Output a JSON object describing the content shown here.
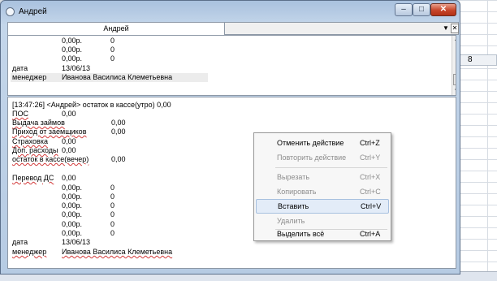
{
  "window": {
    "title": "Андрей"
  },
  "tabs": [
    {
      "label": "Андрей"
    }
  ],
  "background": {
    "column_label": "8"
  },
  "top_pane": {
    "rows": [
      {
        "c2": "0,00р.",
        "c3": "0"
      },
      {
        "c2": "0,00р.",
        "c3": "0"
      },
      {
        "c2": "0,00р.",
        "c3": "0"
      }
    ],
    "date_label": "дата",
    "date_value": "13/06/13",
    "manager_label": "менеджер",
    "manager_value": "Иванова Василиса Клеметьевна"
  },
  "bottom_pane": {
    "header": "[13:47:26] <Андрей> остаток в кассе(утро)  0,00",
    "lines": [
      {
        "label": "ПОС",
        "value": "0,00"
      },
      {
        "label": "Выдача займов",
        "value": "0,00"
      },
      {
        "label": "Приход от заемщиков",
        "value": "0,00"
      },
      {
        "label": "Страховка",
        "value": "0,00"
      },
      {
        "label": "Доп. расходы",
        "value": "0,00"
      },
      {
        "label": "остаток в кассе(вечер)",
        "value": "0,00"
      }
    ],
    "transfer_label": "Перевод ДС",
    "transfer_value": "0,00",
    "rows": [
      {
        "c2": "0,00р.",
        "c3": "0"
      },
      {
        "c2": "0,00р.",
        "c3": "0"
      },
      {
        "c2": "0,00р.",
        "c3": "0"
      },
      {
        "c2": "0,00р.",
        "c3": "0"
      },
      {
        "c2": "0,00р.",
        "c3": "0"
      },
      {
        "c2": "0,00р.",
        "c3": "0"
      }
    ],
    "date_label": "дата",
    "date_value": "13/06/13",
    "manager_label": "менеджер",
    "manager_value": "Иванова Василиса Клеметьевна"
  },
  "context_menu": {
    "items": [
      {
        "label": "Отменить действие",
        "shortcut": "Ctrl+Z",
        "enabled": true
      },
      {
        "label": "Повторить действие",
        "shortcut": "Ctrl+Y",
        "enabled": false
      },
      {
        "label": "Вырезать",
        "shortcut": "Ctrl+X",
        "enabled": false
      },
      {
        "label": "Копировать",
        "shortcut": "Ctrl+C",
        "enabled": false
      },
      {
        "label": "Вставить",
        "shortcut": "Ctrl+V",
        "enabled": true,
        "highlighted": true
      },
      {
        "label": "Удалить",
        "shortcut": "",
        "enabled": false
      },
      {
        "label": "Выделить всё",
        "shortcut": "Ctrl+A",
        "enabled": true
      }
    ]
  },
  "caption_buttons": {
    "minimize": "–",
    "maximize": "□",
    "close": "✕"
  },
  "icons": {
    "tab_dropdown": "▼",
    "tab_close": "✕",
    "scroll_up": "▲",
    "scroll_down": "▼"
  }
}
